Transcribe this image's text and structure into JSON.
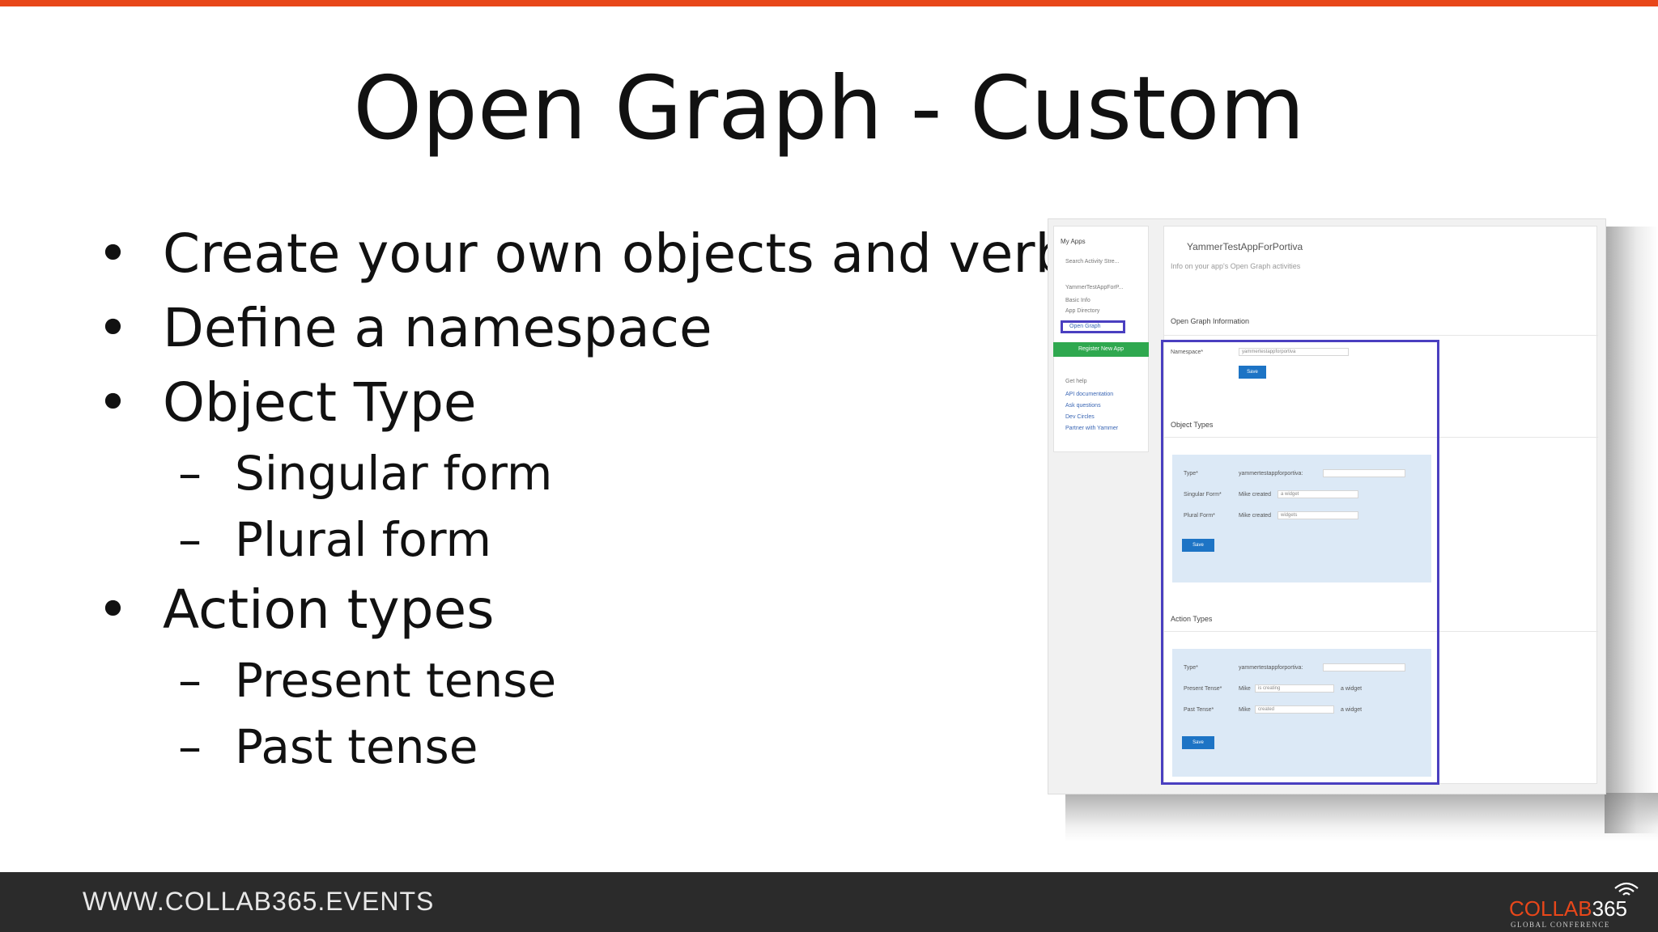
{
  "slide": {
    "title": "Open Graph - Custom",
    "bullets": [
      {
        "text": "Create your own objects and verbs",
        "level": 1
      },
      {
        "text": "Define a namespace",
        "level": 1
      },
      {
        "text": "Object Type",
        "level": 1
      },
      {
        "text": "Singular form",
        "level": 2
      },
      {
        "text": "Plural form",
        "level": 2
      },
      {
        "text": "Action types",
        "level": 1
      },
      {
        "text": "Present tense",
        "level": 2
      },
      {
        "text": "Past tense",
        "level": 2
      }
    ]
  },
  "screenshot": {
    "sidebar": {
      "heading": "My Apps",
      "items": [
        "Search Activity Stre...",
        "YammerTestAppForP...",
        "Basic Info",
        "App Directory"
      ],
      "highlighted_item": "Open Graph",
      "register_button": "Register New App",
      "help_heading": "Get help",
      "help_links": [
        "API documentation",
        "Ask questions",
        "Dev Circles",
        "Partner with Yammer"
      ]
    },
    "main": {
      "app_title": "YammerTestAppForPortiva",
      "subtitle": "Info on your app's Open Graph activities",
      "og_info_heading": "Open Graph Information",
      "namespace_label": "Namespace*",
      "namespace_value": "yammertestappforportiva",
      "namespace_button": "Save",
      "object_types_heading": "Object Types",
      "object_type_label": "Type*",
      "object_type_value": "yammertestappforportiva:",
      "singular_label": "Singular Form*",
      "singular_prefix": "Mike created",
      "singular_value": "a widget",
      "plural_label": "Plural Form*",
      "plural_prefix": "Mike created",
      "plural_value": "widgets",
      "object_save": "Save",
      "action_types_heading": "Action Types",
      "action_type_label": "Type*",
      "action_type_value": "yammertestappforportiva:",
      "present_label": "Present Tense*",
      "present_prefix": "Mike",
      "present_value": "is creating",
      "present_suffix": "a widget",
      "past_label": "Past Tense*",
      "past_prefix": "Mike",
      "past_value": "created",
      "past_suffix": "a widget",
      "action_save": "Save"
    }
  },
  "footer": {
    "url": "WWW.COLLAB365.EVENTS",
    "logo_brand": "COLLAB",
    "logo_number": "365",
    "logo_tagline": "GLOBAL CONFERENCE"
  },
  "colors": {
    "accent": "#e8471a",
    "footer_bg": "#2b2b2b",
    "highlight": "#4a3fc0"
  }
}
